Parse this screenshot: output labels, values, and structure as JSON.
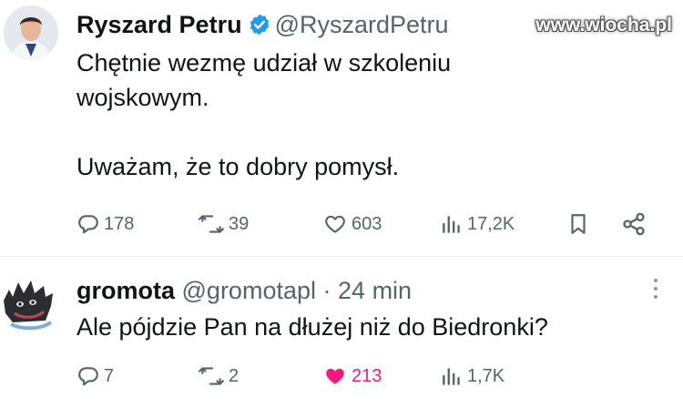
{
  "watermark": "www.wiocha.pl",
  "colors": {
    "text": "#0f1419",
    "muted": "#536471",
    "verified": "#1d9bf0",
    "like": "#f91880"
  },
  "tweets": [
    {
      "author_name": "Ryszard Petru",
      "handle": "@RyszardPetru",
      "verified": true,
      "body_line1": "Chętnie wezmę udział w szkoleniu wojskowym.",
      "body_line2": "Uważam, że to dobry pomysł.",
      "replies": "178",
      "reposts": "39",
      "likes": "603",
      "views": "17,2K",
      "icons": [
        "reply-icon",
        "repost-icon",
        "like-icon",
        "views-icon",
        "bookmark-icon",
        "share-icon"
      ]
    },
    {
      "author_name": "gromota",
      "handle": "@gromotapl",
      "separator": "·",
      "time": "24 min",
      "body": "Ale pójdzie Pan na dłużej niż do Biedronki?",
      "replies": "7",
      "reposts": "2",
      "likes": "213",
      "liked": true,
      "views": "1,7K",
      "icons": [
        "reply-icon",
        "repost-icon",
        "like-icon-filled",
        "views-icon",
        "more-icon"
      ]
    }
  ]
}
